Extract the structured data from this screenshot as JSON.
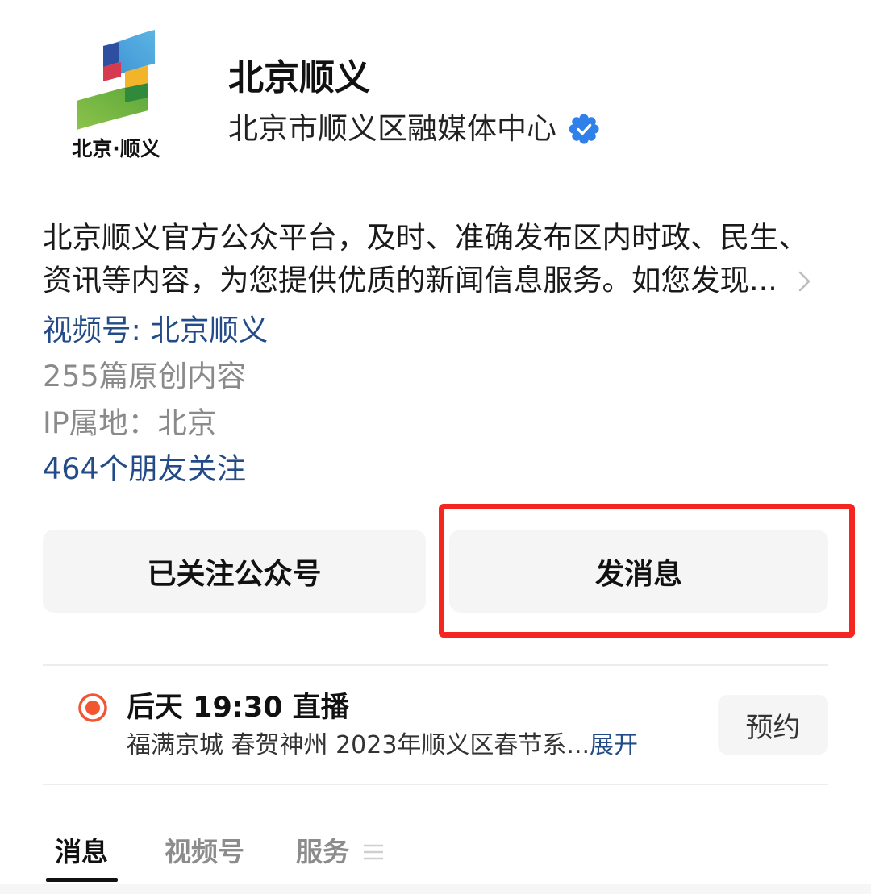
{
  "account": {
    "logo_text": "北京·顺义",
    "name": "北京顺义",
    "org": "北京市顺义区融媒体中心",
    "verified_icon": "verified-badge-icon",
    "description": [
      "北京顺义官方公众平台，及时、准确发布区内时政、民生、",
      "资讯等内容，为您提供优质的新闻信息服务。如您发现..."
    ],
    "channels_link": "视频号: 北京顺义",
    "original_count": "255篇原创内容",
    "ip_location": "IP属地：北京",
    "friends_following": "464个朋友关注"
  },
  "actions": {
    "followed_label": "已关注公众号",
    "message_label": "发消息"
  },
  "live": {
    "icon": "live-record-icon",
    "time_label": "后天 19:30 直播",
    "summary": "福满京城 春贺神州  2023年顺义区春节系...",
    "expand_label": "展开",
    "reserve_label": "预约"
  },
  "tabs": [
    {
      "label": "消息",
      "active": true
    },
    {
      "label": "视频号",
      "active": false
    },
    {
      "label": "服务",
      "active": false,
      "icon": "menu-lines-icon"
    }
  ],
  "colors": {
    "link": "#234b87",
    "highlight": "#f5261f",
    "live_red": "#f2552f",
    "verified": "#2f80e8"
  }
}
